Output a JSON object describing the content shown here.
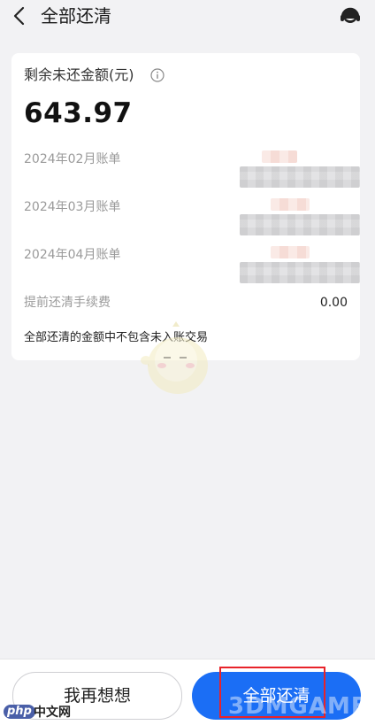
{
  "header": {
    "title": "全部还清",
    "back_icon": "chevron-left-icon",
    "service_icon": "customer-service-headset-icon"
  },
  "summary": {
    "remaining_label": "剩余未还金额(元)",
    "info_icon": "info-circle-icon",
    "amount": "643.97"
  },
  "bills": [
    {
      "label": "2024年02月账单"
    },
    {
      "label": "2024年03月账单"
    },
    {
      "label": "2024年04月账单"
    }
  ],
  "fee": {
    "label": "提前还清手续费",
    "value": "0.00"
  },
  "note": "全部还清的金额中不包含未入账交易",
  "actions": {
    "think_label": "我再想想",
    "repay_label": "全部还清"
  },
  "watermarks": {
    "php": "php",
    "php_cn": "中文网",
    "game": "3DMGAME"
  },
  "colors": {
    "primary": "#1b6ef5",
    "highlight": "#e8232a",
    "background": "#f2f2f4"
  }
}
